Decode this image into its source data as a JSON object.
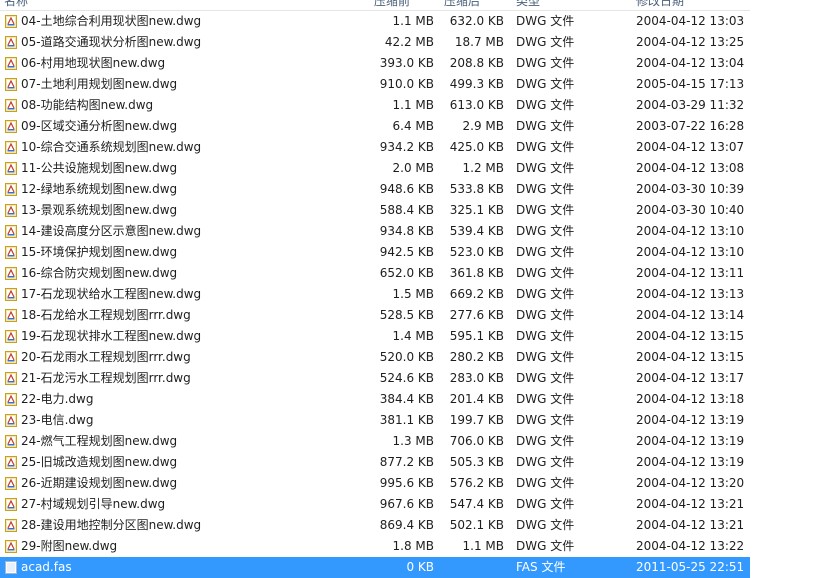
{
  "columns": {
    "name": "名称",
    "compressed": "压缩前",
    "size": "压缩后",
    "type": "类型",
    "modified": "修改日期"
  },
  "files": [
    {
      "name": "04-土地综合利用现状图new.dwg",
      "compressed": "1.1 MB",
      "size": "632.0 KB",
      "type": "DWG 文件",
      "modified": "2004-04-12 13:03"
    },
    {
      "name": "05-道路交通现状分析图new.dwg",
      "compressed": "42.2 MB",
      "size": "18.7 MB",
      "type": "DWG 文件",
      "modified": "2004-04-12 13:25"
    },
    {
      "name": "06-村用地现状图new.dwg",
      "compressed": "393.0 KB",
      "size": "208.8 KB",
      "type": "DWG 文件",
      "modified": "2004-04-12 13:04"
    },
    {
      "name": "07-土地利用规划图new.dwg",
      "compressed": "910.0 KB",
      "size": "499.3 KB",
      "type": "DWG 文件",
      "modified": "2005-04-15 17:13"
    },
    {
      "name": "08-功能结构图new.dwg",
      "compressed": "1.1 MB",
      "size": "613.0 KB",
      "type": "DWG 文件",
      "modified": "2004-03-29 11:32"
    },
    {
      "name": "09-区域交通分析图new.dwg",
      "compressed": "6.4 MB",
      "size": "2.9 MB",
      "type": "DWG 文件",
      "modified": "2003-07-22 16:28"
    },
    {
      "name": "10-综合交通系统规划图new.dwg",
      "compressed": "934.2 KB",
      "size": "425.0 KB",
      "type": "DWG 文件",
      "modified": "2004-04-12 13:07"
    },
    {
      "name": "11-公共设施规划图new.dwg",
      "compressed": "2.0 MB",
      "size": "1.2 MB",
      "type": "DWG 文件",
      "modified": "2004-04-12 13:08"
    },
    {
      "name": "12-绿地系统规划图new.dwg",
      "compressed": "948.6 KB",
      "size": "533.8 KB",
      "type": "DWG 文件",
      "modified": "2004-03-30 10:39"
    },
    {
      "name": "13-景观系统规划图new.dwg",
      "compressed": "588.4 KB",
      "size": "325.1 KB",
      "type": "DWG 文件",
      "modified": "2004-03-30 10:40"
    },
    {
      "name": "14-建设高度分区示意图new.dwg",
      "compressed": "934.8 KB",
      "size": "539.4 KB",
      "type": "DWG 文件",
      "modified": "2004-04-12 13:10"
    },
    {
      "name": "15-环境保护规划图new.dwg",
      "compressed": "942.5 KB",
      "size": "523.0 KB",
      "type": "DWG 文件",
      "modified": "2004-04-12 13:10"
    },
    {
      "name": "16-综合防灾规划图new.dwg",
      "compressed": "652.0 KB",
      "size": "361.8 KB",
      "type": "DWG 文件",
      "modified": "2004-04-12 13:11"
    },
    {
      "name": "17-石龙现状给水工程图new.dwg",
      "compressed": "1.5 MB",
      "size": "669.2 KB",
      "type": "DWG 文件",
      "modified": "2004-04-12 13:13"
    },
    {
      "name": "18-石龙给水工程规划图rrr.dwg",
      "compressed": "528.5 KB",
      "size": "277.6 KB",
      "type": "DWG 文件",
      "modified": "2004-04-12 13:14"
    },
    {
      "name": "19-石龙现状排水工程图new.dwg",
      "compressed": "1.4 MB",
      "size": "595.1 KB",
      "type": "DWG 文件",
      "modified": "2004-04-12 13:15"
    },
    {
      "name": "20-石龙雨水工程规划图rrr.dwg",
      "compressed": "520.0 KB",
      "size": "280.2 KB",
      "type": "DWG 文件",
      "modified": "2004-04-12 13:15"
    },
    {
      "name": "21-石龙污水工程规划图rrr.dwg",
      "compressed": "524.6 KB",
      "size": "283.0 KB",
      "type": "DWG 文件",
      "modified": "2004-04-12 13:17"
    },
    {
      "name": "22-电力.dwg",
      "compressed": "384.4 KB",
      "size": "201.4 KB",
      "type": "DWG 文件",
      "modified": "2004-04-12 13:18"
    },
    {
      "name": "23-电信.dwg",
      "compressed": "381.1 KB",
      "size": "199.7 KB",
      "type": "DWG 文件",
      "modified": "2004-04-12 13:19"
    },
    {
      "name": "24-燃气工程规划图new.dwg",
      "compressed": "1.3 MB",
      "size": "706.0 KB",
      "type": "DWG 文件",
      "modified": "2004-04-12 13:19"
    },
    {
      "name": "25-旧城改造规划图new.dwg",
      "compressed": "877.2 KB",
      "size": "505.3 KB",
      "type": "DWG 文件",
      "modified": "2004-04-12 13:19"
    },
    {
      "name": "26-近期建设规划图new.dwg",
      "compressed": "995.6 KB",
      "size": "576.2 KB",
      "type": "DWG 文件",
      "modified": "2004-04-12 13:20"
    },
    {
      "name": "27-村域规划引导new.dwg",
      "compressed": "967.6 KB",
      "size": "547.4 KB",
      "type": "DWG 文件",
      "modified": "2004-04-12 13:21"
    },
    {
      "name": "28-建设用地控制分区图new.dwg",
      "compressed": "869.4 KB",
      "size": "502.1 KB",
      "type": "DWG 文件",
      "modified": "2004-04-12 13:21"
    },
    {
      "name": "29-附图new.dwg",
      "compressed": "1.8 MB",
      "size": "1.1 MB",
      "type": "DWG 文件",
      "modified": "2004-04-12 13:22"
    },
    {
      "name": "acad.fas",
      "compressed": "0 KB",
      "size": "",
      "type": "FAS 文件",
      "modified": "2011-05-25 22:51",
      "selected": true
    }
  ],
  "colors": {
    "selection": "#3399ff",
    "header_text": "#4c607a",
    "icon_border": "#c8a020"
  },
  "icons": {
    "file": "dwg-file-icon"
  }
}
